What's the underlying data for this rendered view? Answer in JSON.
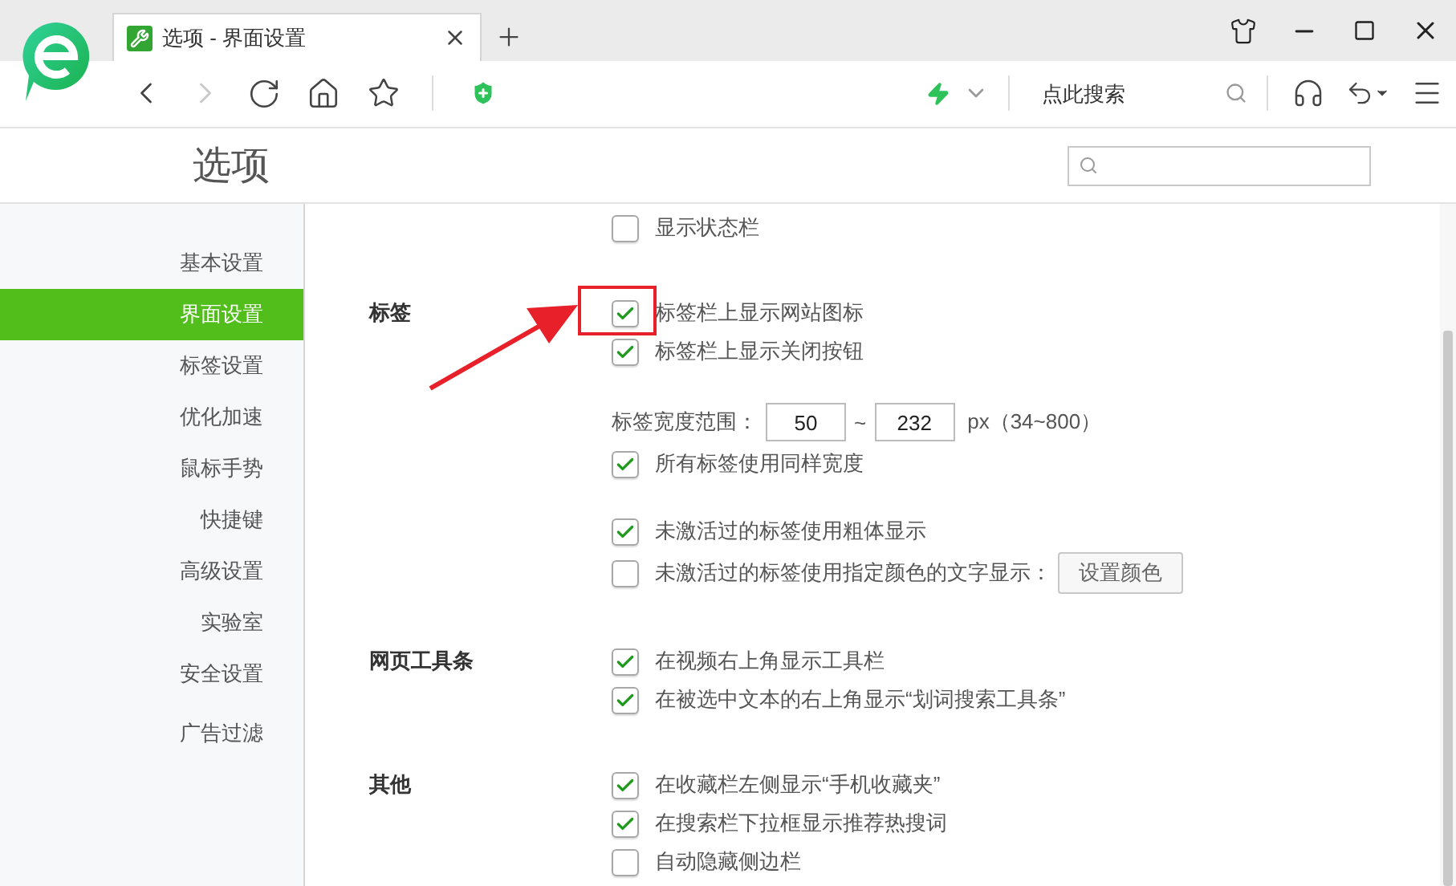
{
  "browser": {
    "tab": {
      "title": "选项 - 界面设置"
    },
    "search": {
      "placeholder": "点此搜索"
    }
  },
  "page": {
    "title": "选项"
  },
  "sidebar": {
    "items": [
      {
        "label": "基本设置",
        "selected": false
      },
      {
        "label": "界面设置",
        "selected": true
      },
      {
        "label": "标签设置",
        "selected": false
      },
      {
        "label": "优化加速",
        "selected": false
      },
      {
        "label": "鼠标手势",
        "selected": false
      },
      {
        "label": "快捷键",
        "selected": false
      },
      {
        "label": "高级设置",
        "selected": false
      },
      {
        "label": "实验室",
        "selected": false
      },
      {
        "label": "安全设置",
        "selected": false
      },
      {
        "label": "广告过滤",
        "selected": false
      }
    ]
  },
  "sections": [
    {
      "groups": [
        [
          {
            "kind": "checkbox",
            "label": "显示状态栏",
            "checked": false
          }
        ]
      ]
    },
    {
      "label": "标签",
      "groups": [
        [
          {
            "kind": "checkbox",
            "label": "标签栏上显示网站图标",
            "checked": true
          },
          {
            "kind": "checkbox",
            "label": "标签栏上显示关闭按钮",
            "checked": true
          }
        ],
        [
          {
            "kind": "range",
            "label": "标签宽度范围：",
            "from": "50",
            "separator": "~",
            "to": "232",
            "hint": "px（34~800）"
          },
          {
            "kind": "checkbox",
            "label": "所有标签使用同样宽度",
            "checked": true
          }
        ],
        [
          {
            "kind": "checkbox",
            "label": "未激活过的标签使用粗体显示",
            "checked": true
          },
          {
            "kind": "checkbox_button",
            "label": "未激活过的标签使用指定颜色的文字显示：",
            "checked": false,
            "button": "设置颜色"
          }
        ]
      ]
    },
    {
      "label": "网页工具条",
      "groups": [
        [
          {
            "kind": "checkbox",
            "label": "在视频右上角显示工具栏",
            "checked": true
          },
          {
            "kind": "checkbox",
            "label": "在被选中文本的右上角显示“划词搜索工具条”",
            "checked": true
          }
        ]
      ]
    },
    {
      "label": "其他",
      "groups": [
        [
          {
            "kind": "checkbox",
            "label": "在收藏栏左侧显示“手机收藏夹”",
            "checked": true
          },
          {
            "kind": "checkbox",
            "label": "在搜索栏下拉框显示推荐热搜词",
            "checked": true
          },
          {
            "kind": "checkbox",
            "label": "自动隐藏侧边栏",
            "checked": false
          }
        ]
      ]
    }
  ]
}
